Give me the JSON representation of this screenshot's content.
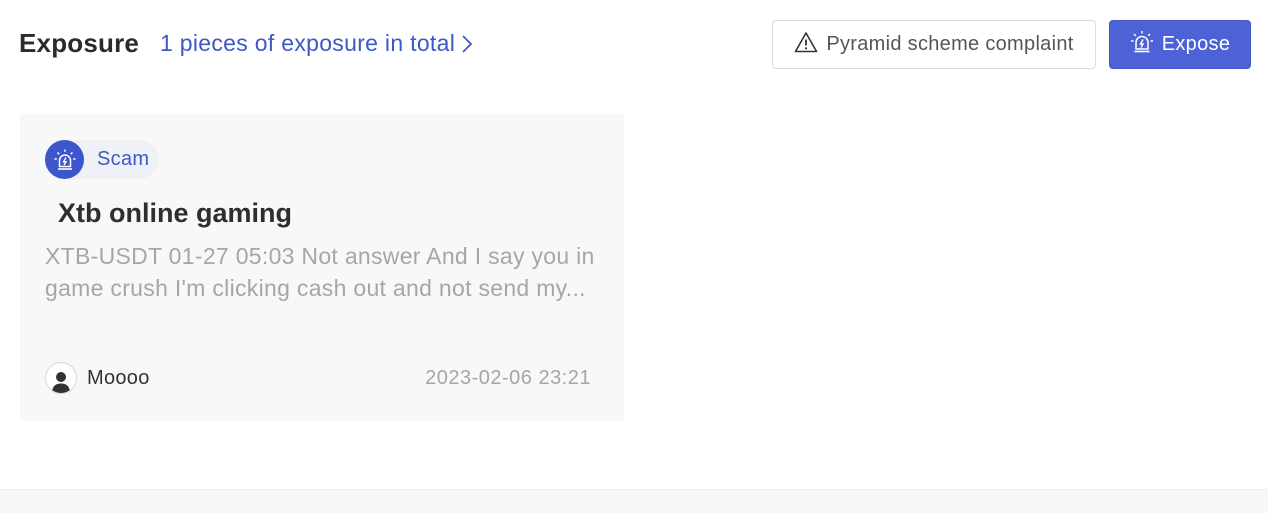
{
  "header": {
    "title": "Exposure",
    "total_link": "1 pieces of exposure in total",
    "complaint_button": "Pyramid scheme complaint",
    "expose_button": "Expose"
  },
  "cards": [
    {
      "tag": "Scam",
      "title": "Xtb online gaming",
      "description": "XTB-USDT 01-27 05:03 Not answer And I say you in game crush I'm clicking cash out and not send my...",
      "author": "Moooo",
      "date": "2023-02-06 23:21"
    }
  ],
  "icons": {
    "total_link": "chevron-right-icon",
    "complaint": "warning-triangle-icon",
    "expose": "alarm-siren-icon",
    "tag": "alarm-siren-icon",
    "avatar": "user-avatar-icon"
  },
  "colors": {
    "accent": "#4d62d6",
    "link": "#3d58c7",
    "muted_text": "#a6a6a6",
    "card_bg": "#f8f8f8"
  }
}
